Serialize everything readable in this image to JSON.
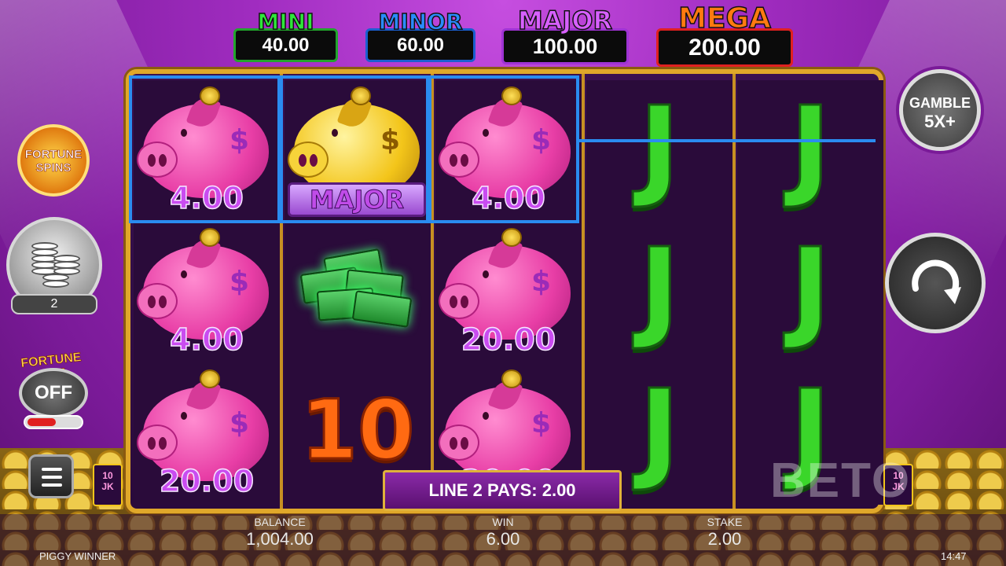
{
  "jackpots": {
    "mini": {
      "label": "MINI",
      "value": "40.00"
    },
    "minor": {
      "label": "MINOR",
      "value": "60.00"
    },
    "major": {
      "label": "MAJOR",
      "value": "100.00"
    },
    "mega": {
      "label": "MEGA",
      "value": "200.00"
    }
  },
  "reels": [
    [
      {
        "type": "pig",
        "value": "4.00"
      },
      {
        "type": "pig",
        "value": "4.00"
      },
      {
        "type": "pig",
        "value": "20.00"
      }
    ],
    [
      {
        "type": "gold-pig",
        "badge": "MAJOR"
      },
      {
        "type": "cash"
      },
      {
        "type": "ten",
        "label": "10"
      }
    ],
    [
      {
        "type": "pig",
        "value": "4.00"
      },
      {
        "type": "pig",
        "value": "20.00"
      },
      {
        "type": "pig",
        "value": "20.00"
      }
    ],
    [
      {
        "type": "j",
        "label": "J"
      },
      {
        "type": "j",
        "label": "J"
      },
      {
        "type": "j",
        "label": "J"
      }
    ],
    [
      {
        "type": "j",
        "label": "J"
      },
      {
        "type": "j",
        "label": "J"
      },
      {
        "type": "j",
        "label": "J"
      }
    ]
  ],
  "left_controls": {
    "fortune_spins": "FORTUNE SPINS",
    "coin_count": "2",
    "fortune_bet_label": "FORTUNE BET",
    "fortune_bet_state": "OFF"
  },
  "right_controls": {
    "gamble_line1": "GAMBLE",
    "gamble_line2": "5X+"
  },
  "paytable_icon_text": "10\nJK",
  "line_pays": "LINE 2 PAYS: 2.00",
  "stats": {
    "balance": {
      "label": "BALANCE",
      "value": "1,004.00"
    },
    "win": {
      "label": "WIN",
      "value": "6.00"
    },
    "stake": {
      "label": "STAKE",
      "value": "2.00"
    }
  },
  "game_name": "PIGGY WINNER",
  "clock": "14:47",
  "watermark": "BETO",
  "colors": {
    "accent": "#2a8cf0",
    "frame": "#e0a82a",
    "background": "#a02cc0"
  }
}
